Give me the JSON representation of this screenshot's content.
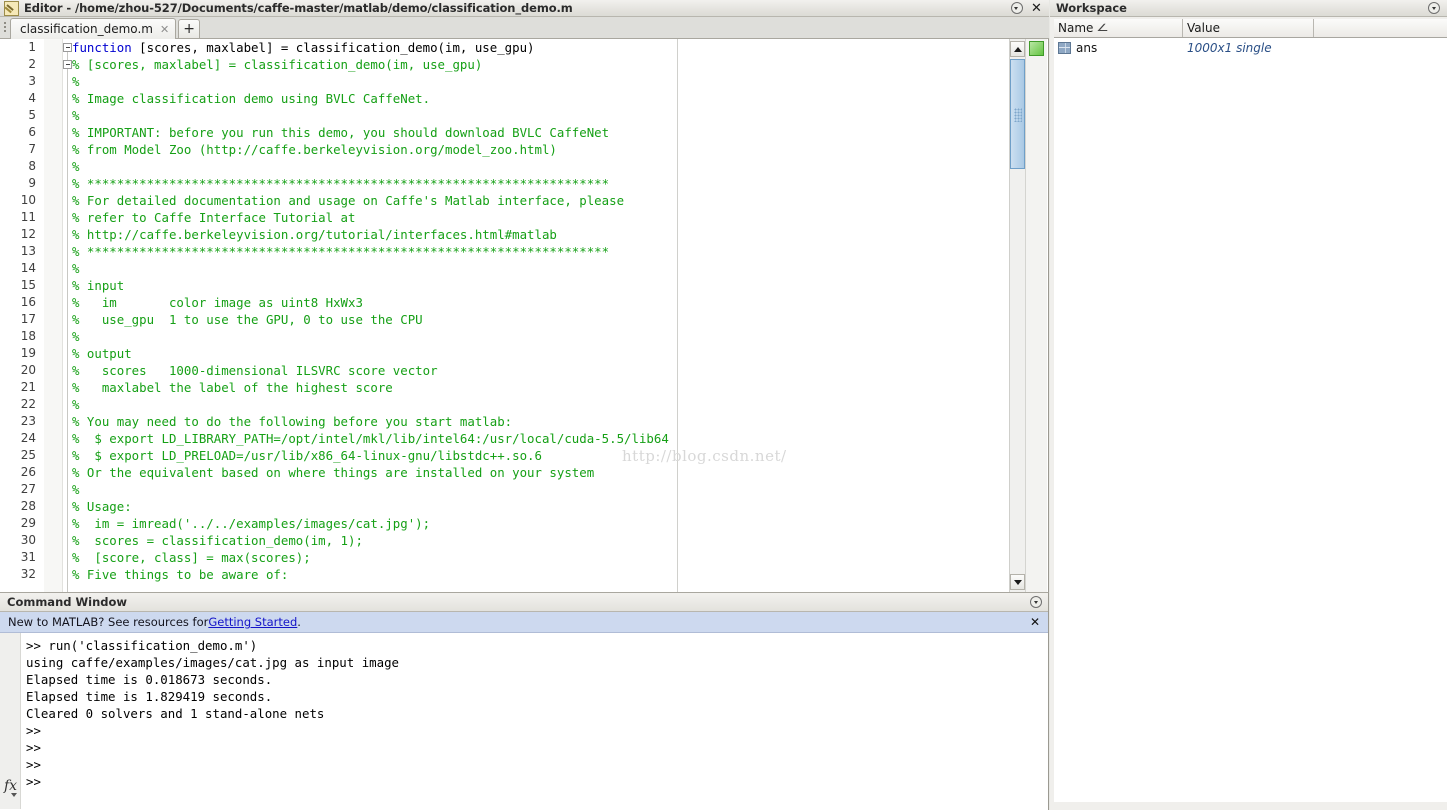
{
  "window": {
    "title": "Editor - /home/zhou-527/Documents/caffe-master/matlab/demo/classification_demo.m",
    "minimize_icon": "chevron-down-circle-icon",
    "close_icon": "✕"
  },
  "tabs": {
    "items": [
      {
        "label": "classification_demo.m",
        "close": "✕"
      }
    ],
    "add_label": "+"
  },
  "editor": {
    "watermark": "http://blog.csdn.net/",
    "lines": [
      {
        "n": "1",
        "kw": "function",
        "rest": " [scores, maxlabel] = classification_demo(im, use_gpu)",
        "type": "code",
        "fold": true
      },
      {
        "n": "2",
        "text": "% [scores, maxlabel] = classification_demo(im, use_gpu)",
        "type": "comment",
        "fold": true
      },
      {
        "n": "3",
        "text": "%",
        "type": "comment"
      },
      {
        "n": "4",
        "text": "% Image classification demo using BVLC CaffeNet.",
        "type": "comment"
      },
      {
        "n": "5",
        "text": "%",
        "type": "comment"
      },
      {
        "n": "6",
        "text": "% IMPORTANT: before you run this demo, you should download BVLC CaffeNet",
        "type": "comment"
      },
      {
        "n": "7",
        "text": "% from Model Zoo (http://caffe.berkeleyvision.org/model_zoo.html)",
        "type": "comment"
      },
      {
        "n": "8",
        "text": "%",
        "type": "comment"
      },
      {
        "n": "9",
        "text": "% **********************************************************************",
        "type": "comment"
      },
      {
        "n": "10",
        "text": "% For detailed documentation and usage on Caffe's Matlab interface, please",
        "type": "comment"
      },
      {
        "n": "11",
        "text": "% refer to Caffe Interface Tutorial at",
        "type": "comment"
      },
      {
        "n": "12",
        "text": "% http://caffe.berkeleyvision.org/tutorial/interfaces.html#matlab",
        "type": "comment"
      },
      {
        "n": "13",
        "text": "% **********************************************************************",
        "type": "comment"
      },
      {
        "n": "14",
        "text": "%",
        "type": "comment"
      },
      {
        "n": "15",
        "text": "% input",
        "type": "comment"
      },
      {
        "n": "16",
        "text": "%   im       color image as uint8 HxWx3",
        "type": "comment"
      },
      {
        "n": "17",
        "text": "%   use_gpu  1 to use the GPU, 0 to use the CPU",
        "type": "comment"
      },
      {
        "n": "18",
        "text": "%",
        "type": "comment"
      },
      {
        "n": "19",
        "text": "% output",
        "type": "comment"
      },
      {
        "n": "20",
        "text": "%   scores   1000-dimensional ILSVRC score vector",
        "type": "comment"
      },
      {
        "n": "21",
        "text": "%   maxlabel the label of the highest score",
        "type": "comment"
      },
      {
        "n": "22",
        "text": "%",
        "type": "comment"
      },
      {
        "n": "23",
        "text": "% You may need to do the following before you start matlab:",
        "type": "comment"
      },
      {
        "n": "24",
        "text": "%  $ export LD_LIBRARY_PATH=/opt/intel/mkl/lib/intel64:/usr/local/cuda-5.5/lib64",
        "type": "comment"
      },
      {
        "n": "25",
        "text": "%  $ export LD_PRELOAD=/usr/lib/x86_64-linux-gnu/libstdc++.so.6",
        "type": "comment"
      },
      {
        "n": "26",
        "text": "% Or the equivalent based on where things are installed on your system",
        "type": "comment"
      },
      {
        "n": "27",
        "text": "%",
        "type": "comment"
      },
      {
        "n": "28",
        "text": "% Usage:",
        "type": "comment"
      },
      {
        "n": "29",
        "text": "%  im = imread('../../examples/images/cat.jpg');",
        "type": "comment"
      },
      {
        "n": "30",
        "text": "%  scores = classification_demo(im, 1);",
        "type": "comment"
      },
      {
        "n": "31",
        "text": "%  [score, class] = max(scores);",
        "type": "comment"
      },
      {
        "n": "32",
        "text": "% Five things to be aware of:",
        "type": "comment"
      }
    ]
  },
  "command_window": {
    "title": "Command Window",
    "banner": {
      "prefix": "New to MATLAB? See resources for ",
      "link": "Getting Started",
      "suffix": ".",
      "close": "✕"
    },
    "output": ">> run('classification_demo.m')\nusing caffe/examples/images/cat.jpg as input image\nElapsed time is 0.018673 seconds.\nElapsed time is 1.829419 seconds.\nCleared 0 solvers and 1 stand-alone nets\n>>\n>>\n>>\n>>",
    "fx_label": "fx"
  },
  "workspace": {
    "title": "Workspace",
    "columns": [
      "Name",
      "Value",
      ""
    ],
    "sort_indicator": "∠",
    "rows": [
      {
        "name": "ans",
        "value": "1000x1 single"
      }
    ]
  },
  "colors": {
    "comment_green": "#16a016",
    "keyword_blue": "#0000d0",
    "banner_blue": "#cdd9ef",
    "link_blue": "#1414c8",
    "scrollbar_thumb": "#b7d2ea",
    "analyzer_ok_green": "#63c441",
    "value_italic_blue": "#2a4f86"
  }
}
